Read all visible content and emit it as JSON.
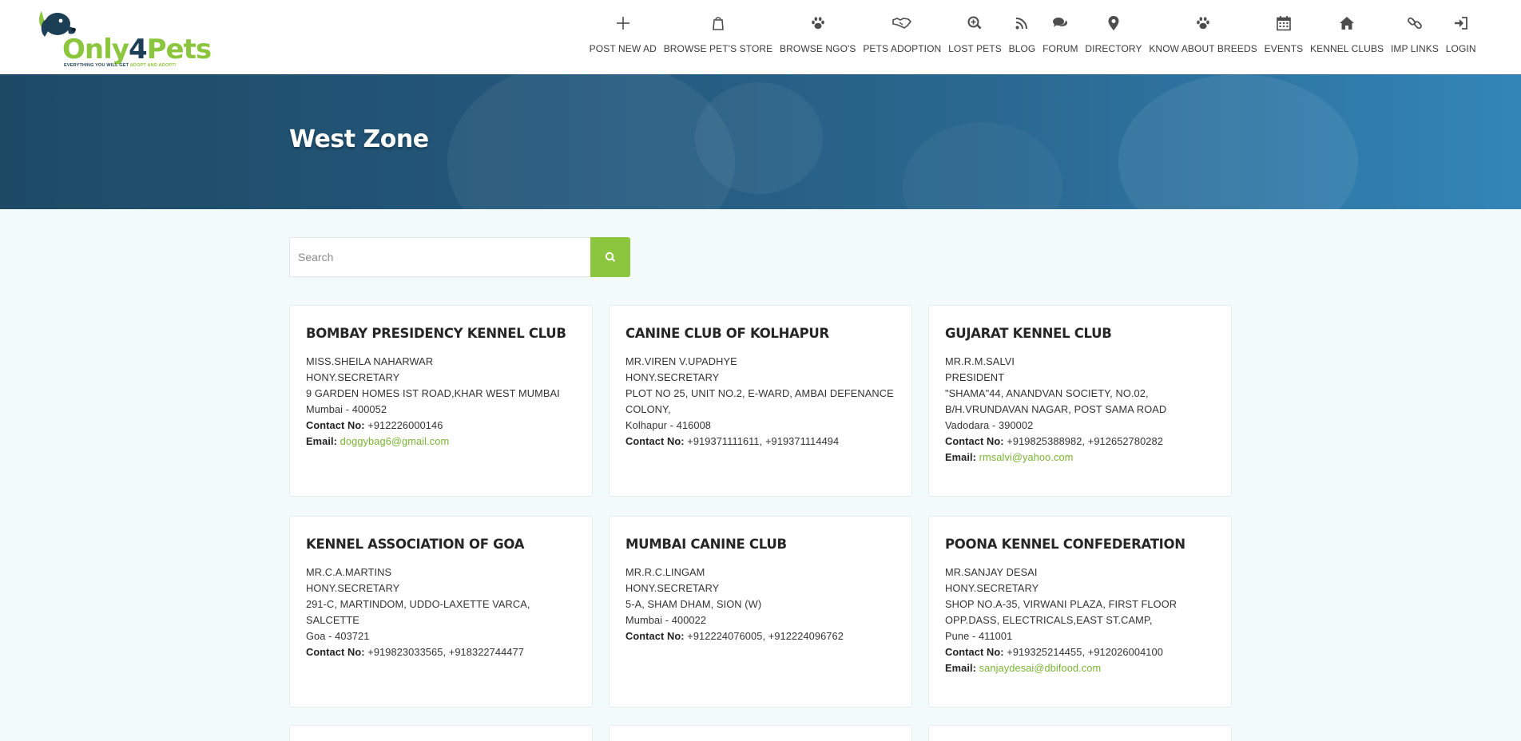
{
  "brand": {
    "name_part1": "Only",
    "name_part2": "4",
    "name_part3": "Pets",
    "tagline_a": "EVERYTHING YOU WILL GET ",
    "tagline_b": "ADOPT AND ADOPT!"
  },
  "nav": [
    {
      "label": "POST NEW AD",
      "icon": "plus-icon"
    },
    {
      "label": "BROWSE PET'S STORE",
      "icon": "shopping-bag-icon"
    },
    {
      "label": "BROWSE NGO'S",
      "icon": "paw-icon"
    },
    {
      "label": "PETS ADOPTION",
      "icon": "handshake-icon"
    },
    {
      "label": "LOST PETS",
      "icon": "search-plus-icon"
    },
    {
      "label": "BLOG",
      "icon": "rss-icon"
    },
    {
      "label": "FORUM",
      "icon": "comments-icon"
    },
    {
      "label": "DIRECTORY",
      "icon": "map-marker-icon"
    },
    {
      "label": "KNOW ABOUT BREEDS",
      "icon": "paw-icon"
    },
    {
      "label": "EVENTS",
      "icon": "calendar-icon"
    },
    {
      "label": "KENNEL CLUBS",
      "icon": "home-icon"
    },
    {
      "label": "IMP LINKS",
      "icon": "link-icon"
    },
    {
      "label": "LOGIN",
      "icon": "sign-in-icon"
    }
  ],
  "hero": {
    "title": "West Zone"
  },
  "search": {
    "placeholder": "Search",
    "value": ""
  },
  "labels": {
    "contact": "Contact No:",
    "email": "Email:"
  },
  "clubs": [
    {
      "name": "BOMBAY PRESIDENCY KENNEL CLUB",
      "person": "MISS.SHEILA NAHARWAR",
      "role": "HONY.SECRETARY",
      "address": [
        "9 GARDEN HOMES IST ROAD,KHAR WEST MUMBAI"
      ],
      "city": "Mumbai - 400052",
      "contact": "+912226000146",
      "email": "doggybag6@gmail.com"
    },
    {
      "name": "CANINE CLUB OF KOLHAPUR",
      "person": "MR.VIREN V.UPADHYE",
      "role": "HONY.SECRETARY",
      "address": [
        "PLOT NO 25, UNIT NO.2, E-WARD, AMBAI DEFENANCE",
        "COLONY,"
      ],
      "city": "Kolhapur - 416008",
      "contact": "+919371111611, +919371114494",
      "email": ""
    },
    {
      "name": "GUJARAT KENNEL CLUB",
      "person": "MR.R.M.SALVI",
      "role": "PRESIDENT",
      "address": [
        "\"SHAMA\"44, ANANDVAN SOCIETY, NO.02,",
        "B/H.VRUNDAVAN NAGAR, POST SAMA ROAD"
      ],
      "city": "Vadodara - 390002",
      "contact": "+919825388982, +912652780282",
      "email": "rmsalvi@yahoo.com"
    },
    {
      "name": "KENNEL ASSOCIATION OF GOA",
      "person": "MR.C.A.MARTINS",
      "role": "HONY.SECRETARY",
      "address": [
        "291-C, MARTINDOM, UDDO-LAXETTE VARCA, SALCETTE"
      ],
      "city": "Goa - 403721",
      "contact": "+919823033565, +918322744477",
      "email": ""
    },
    {
      "name": "MUMBAI CANINE CLUB",
      "person": "MR.R.C.LINGAM",
      "role": "HONY.SECRETARY",
      "address": [
        "5-A, SHAM DHAM, SION (W)"
      ],
      "city": "Mumbai - 400022",
      "contact": "+912224076005, +912224096762",
      "email": ""
    },
    {
      "name": "POONA KENNEL CONFEDERATION",
      "person": "MR.SANJAY DESAI",
      "role": "HONY.SECRETARY",
      "address": [
        "SHOP NO.A-35, VIRWANI PLAZA, FIRST FLOOR",
        "OPP.DASS, ELECTRICALS,EAST ST.CAMP,"
      ],
      "city": "Pune - 411001",
      "contact": "+919325214455, +912026004100",
      "email": "sanjaydesai@dbifood.com"
    }
  ],
  "colors": {
    "accent": "#8cc63f",
    "brand_dark": "#1d3f55",
    "hero_start": "#1e4a66",
    "hero_end": "#3385b8",
    "page_bg": "#f2fafa"
  }
}
